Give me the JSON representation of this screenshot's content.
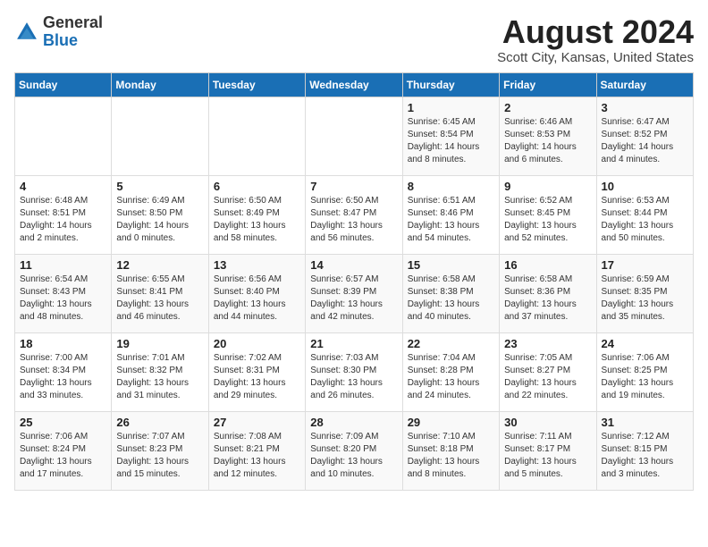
{
  "header": {
    "logo_general": "General",
    "logo_blue": "Blue",
    "month_title": "August 2024",
    "location": "Scott City, Kansas, United States"
  },
  "weekdays": [
    "Sunday",
    "Monday",
    "Tuesday",
    "Wednesday",
    "Thursday",
    "Friday",
    "Saturday"
  ],
  "weeks": [
    [
      {
        "day": "",
        "info": ""
      },
      {
        "day": "",
        "info": ""
      },
      {
        "day": "",
        "info": ""
      },
      {
        "day": "",
        "info": ""
      },
      {
        "day": "1",
        "info": "Sunrise: 6:45 AM\nSunset: 8:54 PM\nDaylight: 14 hours\nand 8 minutes."
      },
      {
        "day": "2",
        "info": "Sunrise: 6:46 AM\nSunset: 8:53 PM\nDaylight: 14 hours\nand 6 minutes."
      },
      {
        "day": "3",
        "info": "Sunrise: 6:47 AM\nSunset: 8:52 PM\nDaylight: 14 hours\nand 4 minutes."
      }
    ],
    [
      {
        "day": "4",
        "info": "Sunrise: 6:48 AM\nSunset: 8:51 PM\nDaylight: 14 hours\nand 2 minutes."
      },
      {
        "day": "5",
        "info": "Sunrise: 6:49 AM\nSunset: 8:50 PM\nDaylight: 14 hours\nand 0 minutes."
      },
      {
        "day": "6",
        "info": "Sunrise: 6:50 AM\nSunset: 8:49 PM\nDaylight: 13 hours\nand 58 minutes."
      },
      {
        "day": "7",
        "info": "Sunrise: 6:50 AM\nSunset: 8:47 PM\nDaylight: 13 hours\nand 56 minutes."
      },
      {
        "day": "8",
        "info": "Sunrise: 6:51 AM\nSunset: 8:46 PM\nDaylight: 13 hours\nand 54 minutes."
      },
      {
        "day": "9",
        "info": "Sunrise: 6:52 AM\nSunset: 8:45 PM\nDaylight: 13 hours\nand 52 minutes."
      },
      {
        "day": "10",
        "info": "Sunrise: 6:53 AM\nSunset: 8:44 PM\nDaylight: 13 hours\nand 50 minutes."
      }
    ],
    [
      {
        "day": "11",
        "info": "Sunrise: 6:54 AM\nSunset: 8:43 PM\nDaylight: 13 hours\nand 48 minutes."
      },
      {
        "day": "12",
        "info": "Sunrise: 6:55 AM\nSunset: 8:41 PM\nDaylight: 13 hours\nand 46 minutes."
      },
      {
        "day": "13",
        "info": "Sunrise: 6:56 AM\nSunset: 8:40 PM\nDaylight: 13 hours\nand 44 minutes."
      },
      {
        "day": "14",
        "info": "Sunrise: 6:57 AM\nSunset: 8:39 PM\nDaylight: 13 hours\nand 42 minutes."
      },
      {
        "day": "15",
        "info": "Sunrise: 6:58 AM\nSunset: 8:38 PM\nDaylight: 13 hours\nand 40 minutes."
      },
      {
        "day": "16",
        "info": "Sunrise: 6:58 AM\nSunset: 8:36 PM\nDaylight: 13 hours\nand 37 minutes."
      },
      {
        "day": "17",
        "info": "Sunrise: 6:59 AM\nSunset: 8:35 PM\nDaylight: 13 hours\nand 35 minutes."
      }
    ],
    [
      {
        "day": "18",
        "info": "Sunrise: 7:00 AM\nSunset: 8:34 PM\nDaylight: 13 hours\nand 33 minutes."
      },
      {
        "day": "19",
        "info": "Sunrise: 7:01 AM\nSunset: 8:32 PM\nDaylight: 13 hours\nand 31 minutes."
      },
      {
        "day": "20",
        "info": "Sunrise: 7:02 AM\nSunset: 8:31 PM\nDaylight: 13 hours\nand 29 minutes."
      },
      {
        "day": "21",
        "info": "Sunrise: 7:03 AM\nSunset: 8:30 PM\nDaylight: 13 hours\nand 26 minutes."
      },
      {
        "day": "22",
        "info": "Sunrise: 7:04 AM\nSunset: 8:28 PM\nDaylight: 13 hours\nand 24 minutes."
      },
      {
        "day": "23",
        "info": "Sunrise: 7:05 AM\nSunset: 8:27 PM\nDaylight: 13 hours\nand 22 minutes."
      },
      {
        "day": "24",
        "info": "Sunrise: 7:06 AM\nSunset: 8:25 PM\nDaylight: 13 hours\nand 19 minutes."
      }
    ],
    [
      {
        "day": "25",
        "info": "Sunrise: 7:06 AM\nSunset: 8:24 PM\nDaylight: 13 hours\nand 17 minutes."
      },
      {
        "day": "26",
        "info": "Sunrise: 7:07 AM\nSunset: 8:23 PM\nDaylight: 13 hours\nand 15 minutes."
      },
      {
        "day": "27",
        "info": "Sunrise: 7:08 AM\nSunset: 8:21 PM\nDaylight: 13 hours\nand 12 minutes."
      },
      {
        "day": "28",
        "info": "Sunrise: 7:09 AM\nSunset: 8:20 PM\nDaylight: 13 hours\nand 10 minutes."
      },
      {
        "day": "29",
        "info": "Sunrise: 7:10 AM\nSunset: 8:18 PM\nDaylight: 13 hours\nand 8 minutes."
      },
      {
        "day": "30",
        "info": "Sunrise: 7:11 AM\nSunset: 8:17 PM\nDaylight: 13 hours\nand 5 minutes."
      },
      {
        "day": "31",
        "info": "Sunrise: 7:12 AM\nSunset: 8:15 PM\nDaylight: 13 hours\nand 3 minutes."
      }
    ]
  ]
}
